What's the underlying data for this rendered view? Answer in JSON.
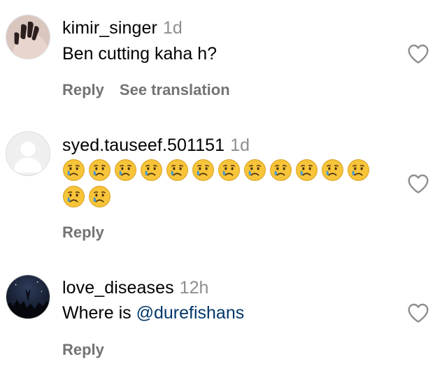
{
  "comments": [
    {
      "username": "kimir_singer",
      "time": "1d",
      "text": "Ben cutting kaha h?",
      "reply_label": "Reply",
      "translate_label": "See translation",
      "avatar_icon": "hand-dark-nails-avatar"
    },
    {
      "username": "syed.tauseef.501151",
      "time": "1d",
      "emoji_name": "crying-face",
      "emoji_count": 14,
      "reply_label": "Reply",
      "avatar_icon": "default-grey-avatar"
    },
    {
      "username": "love_diseases",
      "time": "12h",
      "text_prefix": "Where is ",
      "mention": "@durefishans",
      "reply_label": "Reply",
      "avatar_icon": "night-sky-avatar"
    }
  ],
  "like_icon": "heart-outline-icon",
  "colors": {
    "secondary_text": "#737373",
    "timestamp": "#8e8e8e",
    "mention": "#00376b",
    "emoji_face": "#f7c43a"
  }
}
